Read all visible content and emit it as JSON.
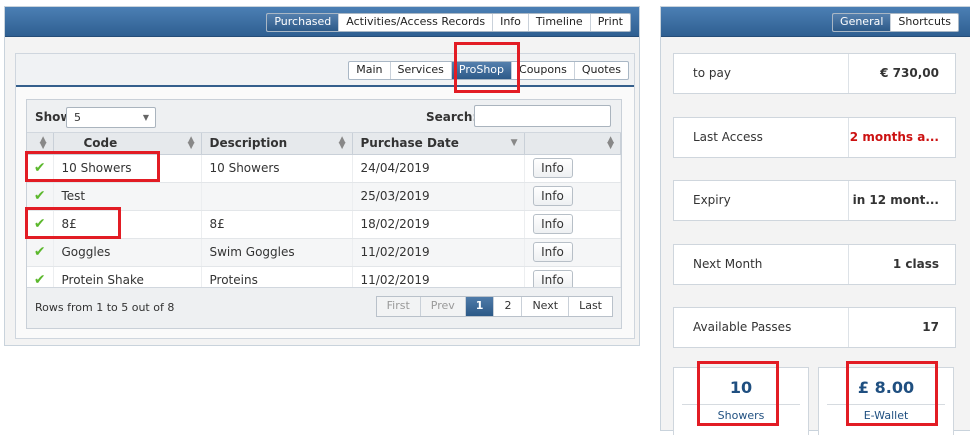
{
  "top_tabs": [
    {
      "label": "Purchased",
      "active": true
    },
    {
      "label": "Activities/Access Records",
      "active": false
    },
    {
      "label": "Info",
      "active": false
    },
    {
      "label": "Timeline",
      "active": false
    },
    {
      "label": "Print",
      "active": false
    }
  ],
  "sub_tabs": [
    {
      "label": "Main",
      "active": false
    },
    {
      "label": "Services",
      "active": false
    },
    {
      "label": "ProShop",
      "active": true
    },
    {
      "label": "Coupons",
      "active": false
    },
    {
      "label": "Quotes",
      "active": false
    }
  ],
  "toolbar": {
    "show_label": "Show",
    "show_value": "5",
    "search_label": "Search:",
    "search_value": ""
  },
  "columns": [
    "",
    "Code",
    "Description",
    "Purchase Date",
    ""
  ],
  "rows": [
    {
      "code": "10 Showers",
      "description": "10 Showers",
      "date": "24/04/2019",
      "action": "Info"
    },
    {
      "code": "Test",
      "description": "",
      "date": "25/03/2019",
      "action": "Info"
    },
    {
      "code": "8£",
      "description": "8£",
      "date": "18/02/2019",
      "action": "Info"
    },
    {
      "code": "Goggles",
      "description": "Swim Goggles",
      "date": "11/02/2019",
      "action": "Info"
    },
    {
      "code": "Protein Shake",
      "description": "Proteins",
      "date": "11/02/2019",
      "action": "Info"
    }
  ],
  "footer": {
    "rows_info": "Rows from 1 to 5 out of 8",
    "pager": [
      "First",
      "Prev",
      "1",
      "2",
      "Next",
      "Last"
    ]
  },
  "right_tabs": [
    {
      "label": "General",
      "active": true
    },
    {
      "label": "Shortcuts",
      "active": false
    }
  ],
  "stats": [
    {
      "key": "to pay",
      "value": "€ 730,00"
    },
    {
      "key": "Last Access",
      "value": "2 months a..."
    },
    {
      "key": "Expiry",
      "value": "in 12 mont..."
    },
    {
      "key": "Next Month",
      "value": "1 class"
    },
    {
      "key": "Available Passes",
      "value": "17"
    }
  ],
  "cards": [
    {
      "value": "10",
      "label": "Showers"
    },
    {
      "value": "£ 8.00",
      "label": "E-Wallet"
    }
  ],
  "colors": {
    "accent": "#2f5f91",
    "alert": "#cc1111",
    "highlight": "#e21c24",
    "check": "#5cb82d"
  }
}
